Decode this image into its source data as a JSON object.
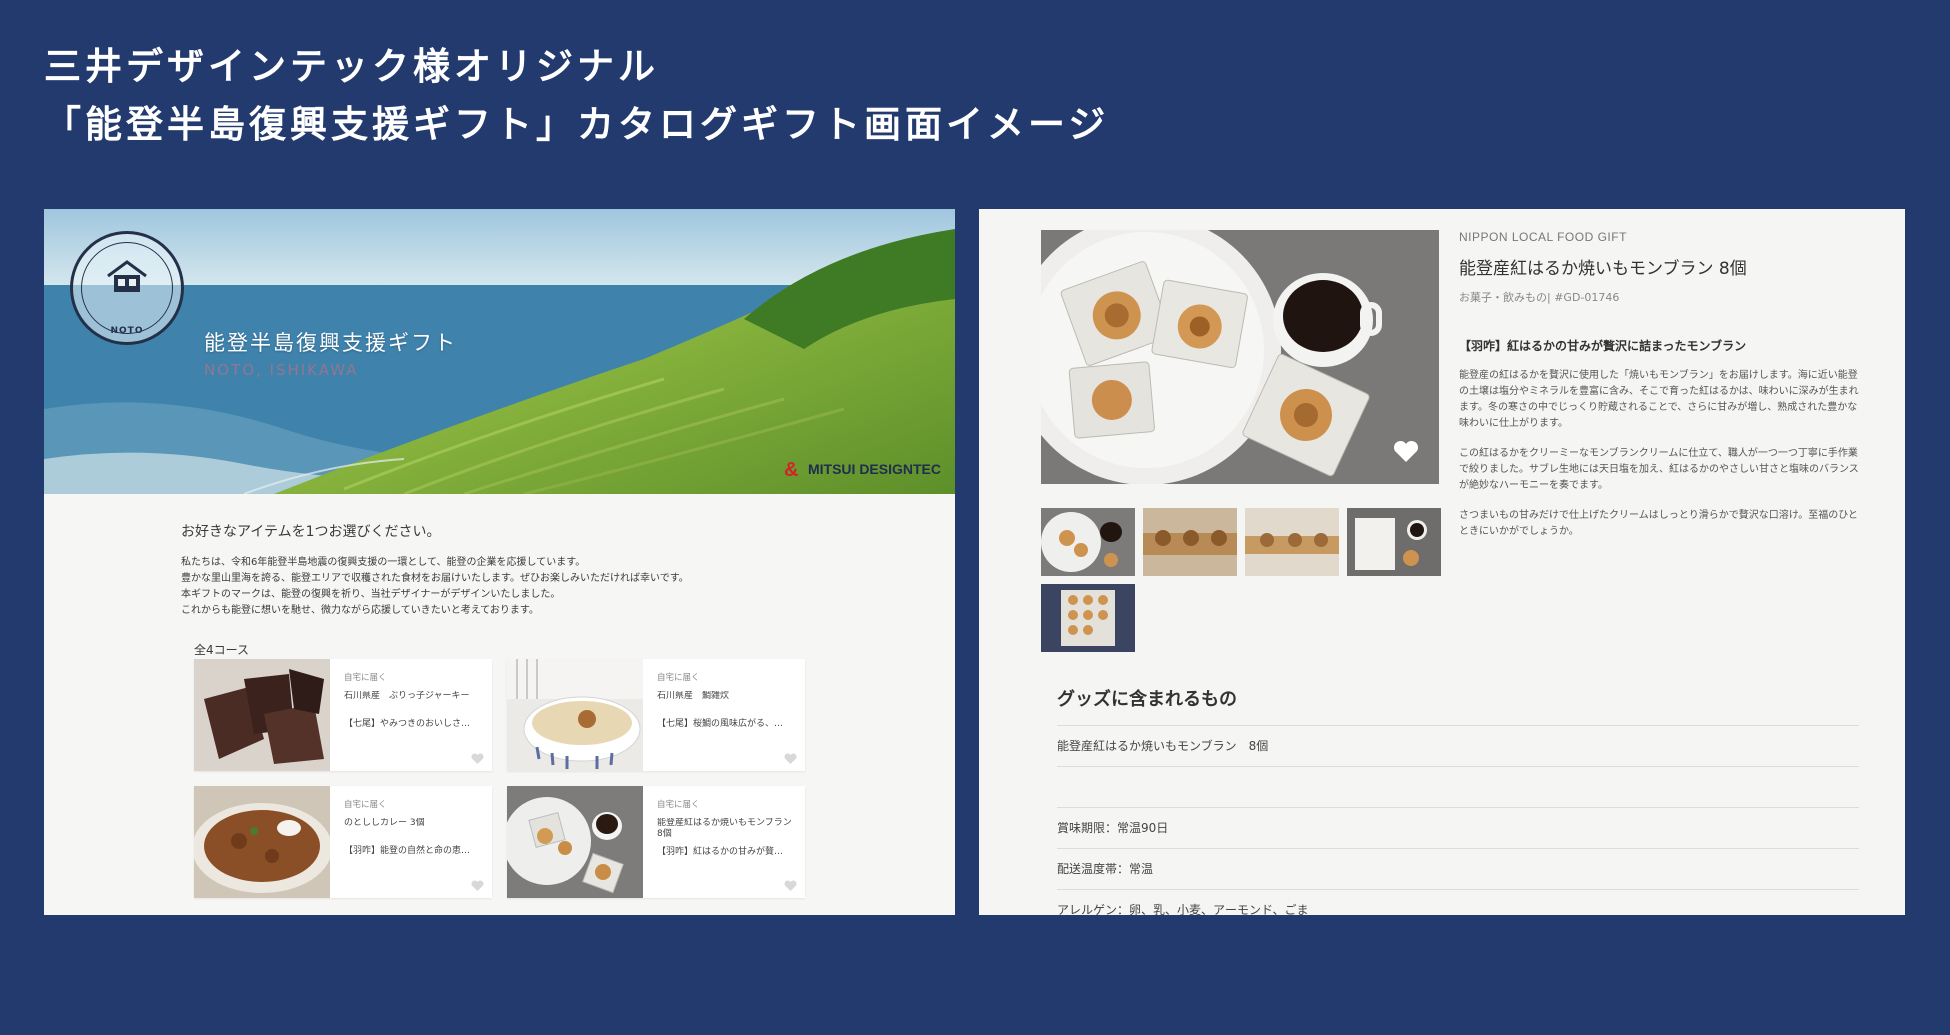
{
  "heading": {
    "line1": "三井デザインテック様オリジナル",
    "line2": "「能登半島復興支援ギフト」カタログギフト画面イメージ"
  },
  "left_screen": {
    "hero": {
      "logo_text": "NOTO",
      "title": "能登半島復興支援ギフト",
      "subtitle": "NOTO, ISHIKAWA",
      "brand": "MITSUI DESIGNTEC"
    },
    "intro": {
      "lead": "お好きなアイテムを1つお選びください。",
      "body": [
        "私たちは、令和6年能登半島地震の復興支援の一環として、能登の企業を応援しています。",
        "豊かな里山里海を誇る、能登エリアで収穫された食材をお届けいたします。ぜひお楽しみいただければ幸いです。",
        "本ギフトのマークは、能登の復興を祈り、当社デザイナーがデザインいたしました。",
        "これからも能登に想いを馳せ、微力ながら応援していきたいと考えております。"
      ]
    },
    "course_count": "全4コース",
    "cards": [
      {
        "tag": "自宅に届く",
        "name": "石川県産　ぶりっ子ジャーキー",
        "desc": "【七尾】やみつきのおいしさ…",
        "icon": "heart-icon"
      },
      {
        "tag": "自宅に届く",
        "name": "石川県産　鯛雑炊",
        "desc": "【七尾】桜鯛の風味広がる、…",
        "icon": "heart-icon"
      },
      {
        "tag": "自宅に届く",
        "name": "のとししカレー 3個",
        "desc": "【羽咋】能登の自然と命の恵…",
        "icon": "heart-icon"
      },
      {
        "tag": "自宅に届く",
        "name": "能登産紅はるか焼いもモンブラン 8個",
        "desc": "【羽咋】紅はるかの甘みが贅…",
        "icon": "heart-icon"
      }
    ]
  },
  "right_screen": {
    "brand_label": "NIPPON LOCAL FOOD GIFT",
    "title": "能登産紅はるか焼いもモンブラン 8個",
    "category": "お菓子・飲みもの| #GD-01746",
    "catch": "【羽咋】紅はるかの甘みが贅沢に詰まったモンブラン",
    "paragraphs": [
      "能登産の紅はるかを贅沢に使用した「焼いもモンブラン」をお届けします。海に近い能登の土壌は塩分やミネラルを豊富に含み、そこで育った紅はるかは、味わいに深みが生まれます。冬の寒さの中でじっくり貯蔵されることで、さらに甘みが増し、熟成された豊かな味わいに仕上がります。",
      "この紅はるかをクリーミーなモンブランクリームに仕立て、職人が一つ一つ丁寧に手作業で絞りました。サブレ生地には天日塩を加え、紅はるかのやさしい甘さと塩味のバランスが絶妙なハーモニーを奏でます。",
      "さつまいもの甘みだけで仕上げたクリームはしっとり滑らかで贅沢な口溶け。至福のひとときにいかがでしょうか。"
    ],
    "section_title": "グッズに含まれるもの",
    "included_item": "能登産紅はるか焼いもモンブラン　8個",
    "specs": [
      "賞味期限：常温90日",
      "配送温度帯：常温",
      "アレルゲン：卵、乳、小麦、アーモンド、ごま"
    ]
  }
}
